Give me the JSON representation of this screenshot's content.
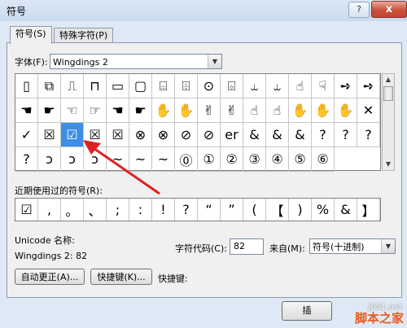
{
  "window": {
    "title": "符号",
    "help_btn": "?",
    "close_btn": "x"
  },
  "tabs": [
    "符号(S)",
    "特殊字符(P)"
  ],
  "font": {
    "label": "字体(F):",
    "value": "Wingdings 2"
  },
  "symbols": [
    "▯",
    "⧉",
    "⎍",
    "⊓",
    "▭",
    "▢",
    "⌸",
    "⌹",
    "⊙",
    "⌺",
    "⥿",
    "⥿",
    "☝",
    "☟",
    "➺",
    "➺",
    "☚",
    "☛",
    "☜",
    "☞",
    "☚",
    "☛",
    "✋",
    "✋",
    "✌",
    "✌",
    "☝",
    "☝",
    "✋",
    "✋",
    "✋",
    "✕",
    "✓",
    "☒",
    "☑",
    "☒",
    "☒",
    "⊗",
    "⊗",
    "⊘",
    "⊘",
    "er",
    "&",
    "&",
    "&",
    "?",
    "?",
    "?",
    "?",
    "ↄ",
    "ↄ",
    "ↄ",
    "~",
    "~",
    "~",
    "⓪",
    "①",
    "②",
    "③",
    "④",
    "⑤",
    "⑥"
  ],
  "recent_label": "近期使用过的符号(R):",
  "recent_symbols": [
    "☑",
    ",",
    "。",
    "、",
    ";",
    ":",
    "!",
    "?",
    "“",
    "”",
    "(",
    "【",
    ")",
    "%",
    "&",
    "】"
  ],
  "unicode_label": "Unicode 名称:",
  "unicode_value": "Wingdings 2: 82",
  "charcode_label": "字符代码(C):",
  "charcode_value": "82",
  "from_label": "来自(M):",
  "from_value": "符号(十进制)",
  "autocorrect_btn": "自动更正(A)...",
  "shortcut_btn": "快捷键(K)...",
  "shortcut_label": "快捷键:",
  "insert_btn": "插",
  "watermark_1": "jb51.net",
  "watermark_2": "脚本之家",
  "accent_color": "#3d8ee6",
  "arrow_color": "#e02020"
}
